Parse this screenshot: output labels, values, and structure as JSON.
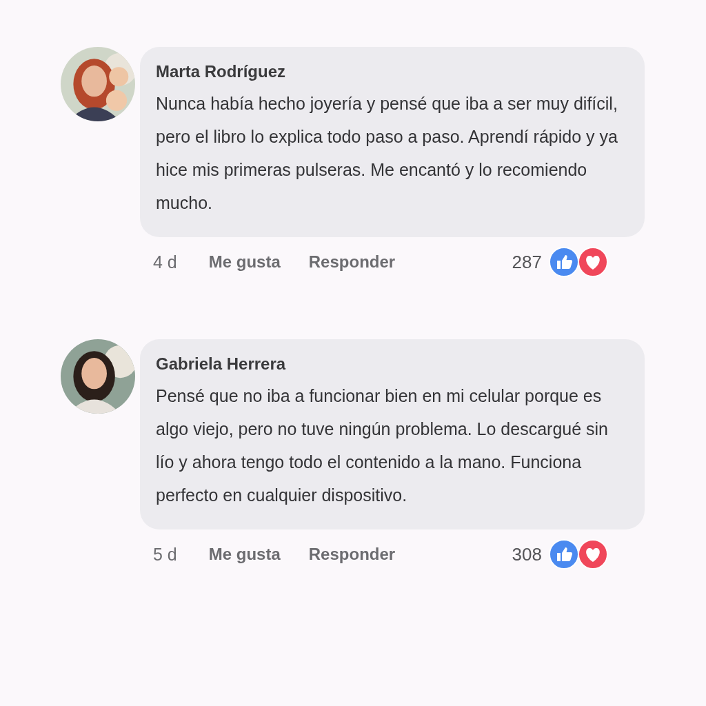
{
  "comments": [
    {
      "author": "Marta Rodríguez",
      "text": "Nunca había hecho joyería y pensé que iba a ser muy difícil, pero el libro lo explica todo paso a paso. Aprendí rápido y ya hice mis primeras pulseras. Me encantó y lo recomiendo mucho.",
      "time": "4 d",
      "like": "Me gusta",
      "reply": "Responder",
      "reaction_count": "287"
    },
    {
      "author": "Gabriela Herrera",
      "text": "Pensé que no iba a funcionar bien en mi celular porque es algo viejo, pero no tuve ningún problema. Lo descargué sin lío y ahora tengo todo el contenido a la mano. Funciona perfecto en cualquier dispositivo.",
      "time": "5 d",
      "like": "Me gusta",
      "reply": "Responder",
      "reaction_count": "308"
    }
  ]
}
